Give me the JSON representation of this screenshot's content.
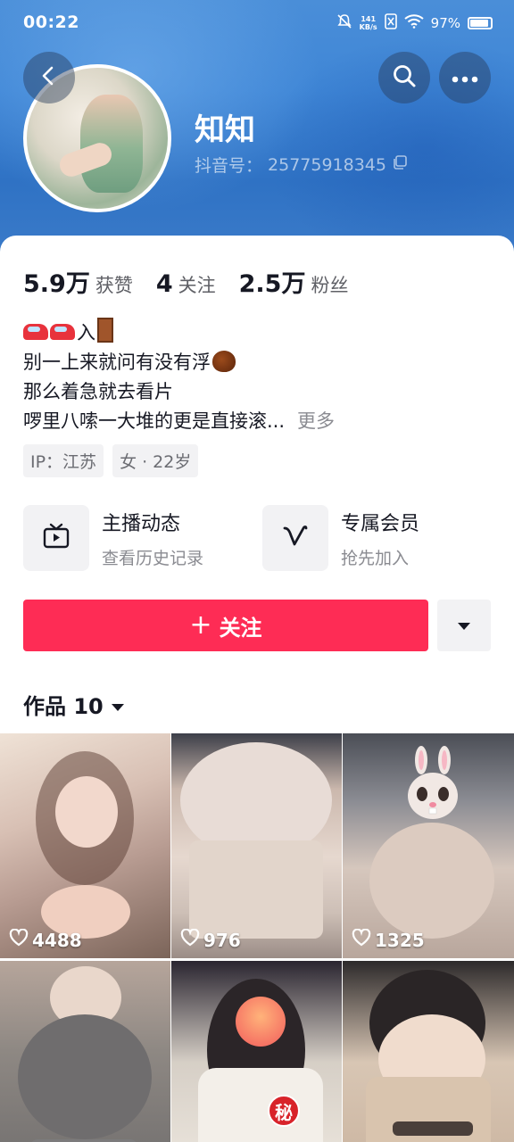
{
  "status_bar": {
    "time": "00:22",
    "net_speed_value": "141",
    "net_speed_unit": "KB/s",
    "battery": "97%"
  },
  "profile": {
    "name": "知知",
    "id_label": "抖音号：",
    "id_value": "25775918345"
  },
  "stats": [
    {
      "value": "5.9万",
      "label": "获赞"
    },
    {
      "value": "4",
      "label": "关注"
    },
    {
      "value": "2.5万",
      "label": "粉丝"
    }
  ],
  "bio": {
    "line1_text": "入",
    "line2": "别一上来就问有没有浮",
    "line3": "那么着急就去看片",
    "line4": "啰里八嗦一大堆的更是直接滚...",
    "more": "更多"
  },
  "tags": {
    "ip": "IP：江苏",
    "gender_age": "女 · 22岁"
  },
  "features": {
    "live": {
      "title": "主播动态",
      "sub": "查看历史记录"
    },
    "member": {
      "title": "专属会员",
      "sub": "抢先加入"
    }
  },
  "actions": {
    "follow_plus": "+",
    "follow_label": "关注"
  },
  "works": {
    "title": "作品 10",
    "items": [
      {
        "likes": "4488"
      },
      {
        "likes": "976"
      },
      {
        "likes": "1325"
      },
      {
        "likes": ""
      },
      {
        "likes": ""
      },
      {
        "likes": ""
      }
    ],
    "stamp_text": "秘"
  },
  "colors": {
    "accent": "#fe2c55",
    "header_blue": "#3f86d6"
  },
  "icons": [
    "back-icon",
    "search-icon",
    "more-icon",
    "copy-icon",
    "tv-icon",
    "member-v-icon",
    "chevron-down-icon",
    "heart-icon"
  ]
}
